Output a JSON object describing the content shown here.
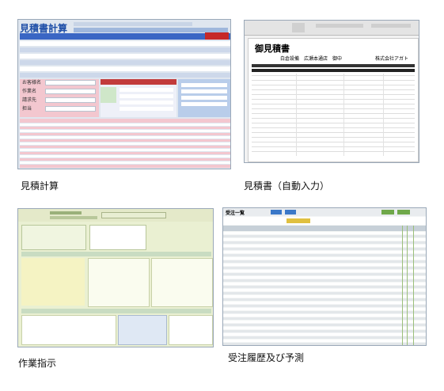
{
  "thumbnails": [
    {
      "caption": "見積計算",
      "ui_title": "見積書計算",
      "fields": [
        "お客様名",
        "作業名",
        "請求先",
        "担当"
      ]
    },
    {
      "caption": "見積書（自動入力）",
      "doc_title": "御見積書",
      "customer": "白倉設備　広瀬本通店　御中",
      "company": "株式会社アガト"
    },
    {
      "caption": "作業指示"
    },
    {
      "caption": "受注履歴及び予測",
      "ui_title": "受注一覧"
    }
  ]
}
